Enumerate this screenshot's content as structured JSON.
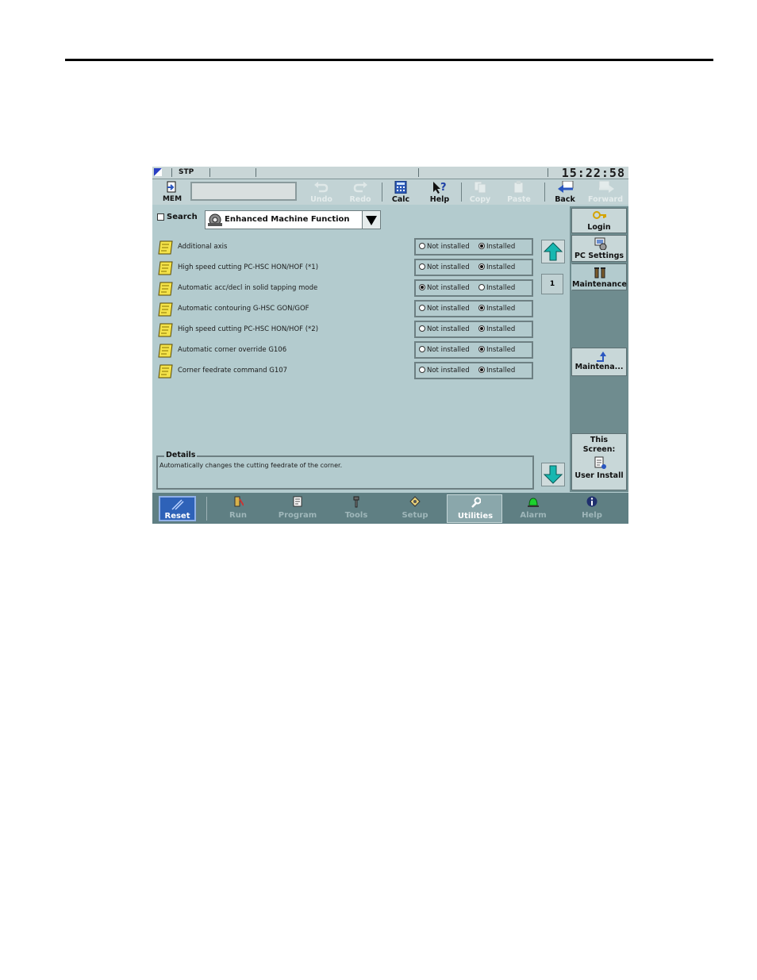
{
  "status": {
    "mode": "STP",
    "time": "15:22:58"
  },
  "toolbar": {
    "mem_label": "MEM",
    "buttons": [
      {
        "label": "Undo",
        "icon": "undo-icon",
        "enabled": false
      },
      {
        "label": "Redo",
        "icon": "redo-icon",
        "enabled": false
      },
      {
        "label": "Calc",
        "icon": "calculator-icon",
        "enabled": true
      },
      {
        "label": "Help",
        "icon": "help-pointer-icon",
        "enabled": true
      },
      {
        "label": "Copy",
        "icon": "copy-icon",
        "enabled": false
      },
      {
        "label": "Paste",
        "icon": "paste-icon",
        "enabled": false
      },
      {
        "label": "Back",
        "icon": "back-arrow-icon",
        "enabled": true
      },
      {
        "label": "Forward",
        "icon": "forward-arrow-icon",
        "enabled": false
      }
    ]
  },
  "search": {
    "label": "Search",
    "checked": false
  },
  "category": {
    "selected": "Enhanced Machine Function"
  },
  "options": {
    "choice_labels": [
      "Not installed",
      "Installed"
    ],
    "rows": [
      {
        "label": "Additional axis",
        "value": "Installed"
      },
      {
        "label": "High speed cutting PC-HSC HON/HOF (*1)",
        "value": "Installed"
      },
      {
        "label": "Automatic acc/decl in solid tapping mode",
        "value": "Not installed"
      },
      {
        "label": "Automatic contouring G-HSC GON/GOF",
        "value": "Installed"
      },
      {
        "label": "High speed cutting PC-HSC HON/HOF (*2)",
        "value": "Installed"
      },
      {
        "label": "Automatic corner override G106",
        "value": "Installed"
      },
      {
        "label": "Corner feedrate command G107",
        "value": "Installed"
      }
    ]
  },
  "page": {
    "number": "1"
  },
  "details": {
    "title": "Details",
    "text": "Automatically changes the cutting feedrate of the corner."
  },
  "side": {
    "login": "Login",
    "pc_settings": "PC Settings",
    "maintenance": "Maintenance",
    "maintena": "Maintena...",
    "this_screen_1": "This",
    "this_screen_2": "Screen:",
    "user_install": "User Install"
  },
  "bottom_nav": {
    "reset": "Reset",
    "items": [
      {
        "label": "Run",
        "icon": "run-icon"
      },
      {
        "label": "Program",
        "icon": "program-icon"
      },
      {
        "label": "Tools",
        "icon": "tools-icon"
      },
      {
        "label": "Setup",
        "icon": "setup-icon"
      },
      {
        "label": "Utilities",
        "icon": "wrench-icon",
        "active": true
      },
      {
        "label": "Alarm",
        "icon": "alarm-lamp-icon"
      },
      {
        "label": "Help",
        "icon": "info-icon"
      }
    ]
  },
  "colors": {
    "panel": "#b3cbce",
    "side_panel": "#6f8c8f",
    "bottom_bar": "#5f7f83",
    "reset": "#2e62b8"
  }
}
